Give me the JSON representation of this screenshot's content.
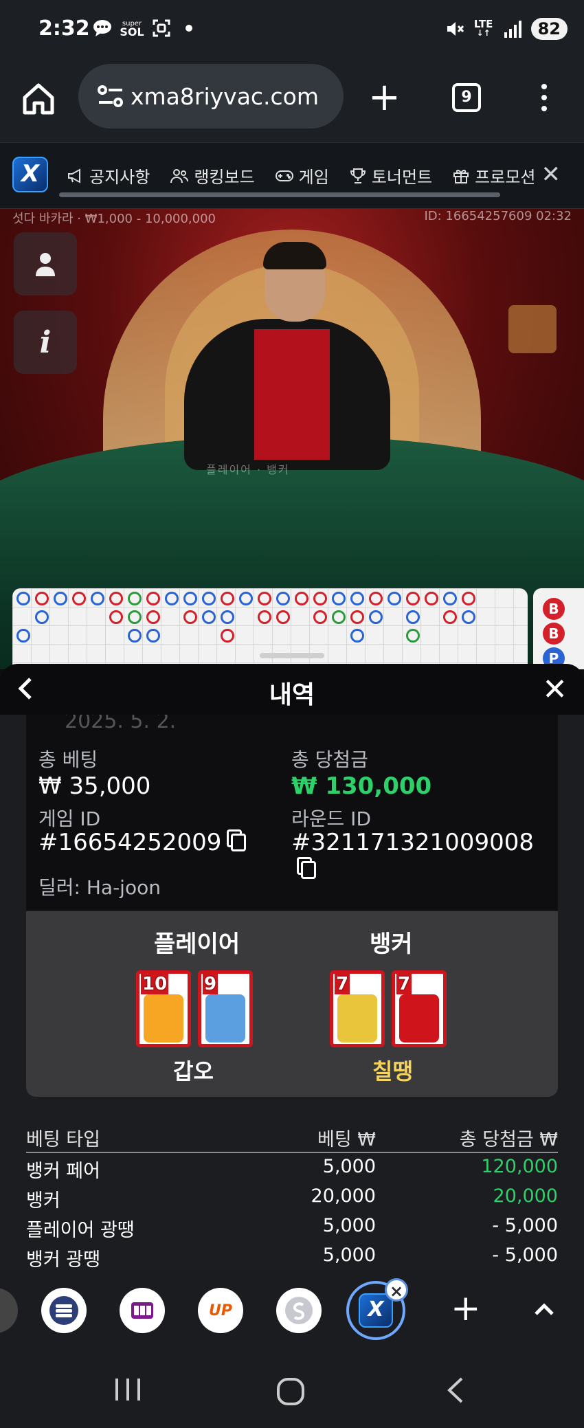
{
  "status_bar": {
    "time": "2:32",
    "network": "LTE",
    "battery": "82",
    "icons": [
      "chat-bubble-icon",
      "super-sol-icon",
      "screenshot-icon",
      "dot-icon",
      "mute-icon",
      "lte-icon",
      "signal-icon"
    ],
    "super_label": "super",
    "sol_label": "SOL"
  },
  "browser": {
    "url": "xma8riyvac.com",
    "tab_count": "9"
  },
  "site_nav": {
    "logo": "X",
    "items": [
      {
        "label": "공지사항",
        "icon": "megaphone-icon"
      },
      {
        "label": "랭킹보드",
        "icon": "users-icon"
      },
      {
        "label": "게임",
        "icon": "gamepad-icon"
      },
      {
        "label": "토너먼트",
        "icon": "trophy-icon"
      },
      {
        "label": "프로모션",
        "icon": "gift-icon"
      }
    ]
  },
  "video": {
    "table_info": "섯다 바카라 · ₩1,000 - 10,000,000",
    "round_info": "ID: 16654257609 02:32",
    "table_marking": "플레이어 · 뱅커"
  },
  "road": {
    "bead_labels": [
      "B",
      "B",
      "P"
    ]
  },
  "history": {
    "title": "내역",
    "date": "2025. 5. 2.",
    "total_bet_label": "총 베팅",
    "total_bet": "₩ 35,000",
    "total_win_label": "총 당첨금",
    "total_win": "₩ 130,000",
    "game_id_label": "게임 ID",
    "game_id": "#16654252009",
    "round_id_label": "라운드 ID",
    "round_id": "#321171321009008",
    "dealer": "딜러: Ha-joon",
    "player_label": "플레이어",
    "banker_label": "뱅커",
    "player_cards": [
      "10",
      "9"
    ],
    "banker_cards": [
      "7",
      "7"
    ],
    "player_result": "갑오",
    "banker_result": "칠땡",
    "table_headers": {
      "type": "베팅 타입",
      "bet": "베팅 ₩",
      "win": "총 당첨금 ₩"
    },
    "rows": [
      {
        "type": "뱅커 페어",
        "bet": "5,000",
        "win": "120,000",
        "positive": true
      },
      {
        "type": "뱅커",
        "bet": "20,000",
        "win": "20,000",
        "positive": true
      },
      {
        "type": "플레이어 광땡",
        "bet": "5,000",
        "win": "- 5,000",
        "positive": false
      },
      {
        "type": "뱅커 광땡",
        "bet": "5,000",
        "win": "- 5,000",
        "positive": false
      }
    ]
  },
  "dock": {
    "close_badge": "×"
  },
  "colors": {
    "win_green": "#2ed06a",
    "result_yellow": "#f4d35e",
    "card_red": "#d0141c",
    "player_blue": "#2a63d4",
    "banker_red": "#d3202a"
  }
}
